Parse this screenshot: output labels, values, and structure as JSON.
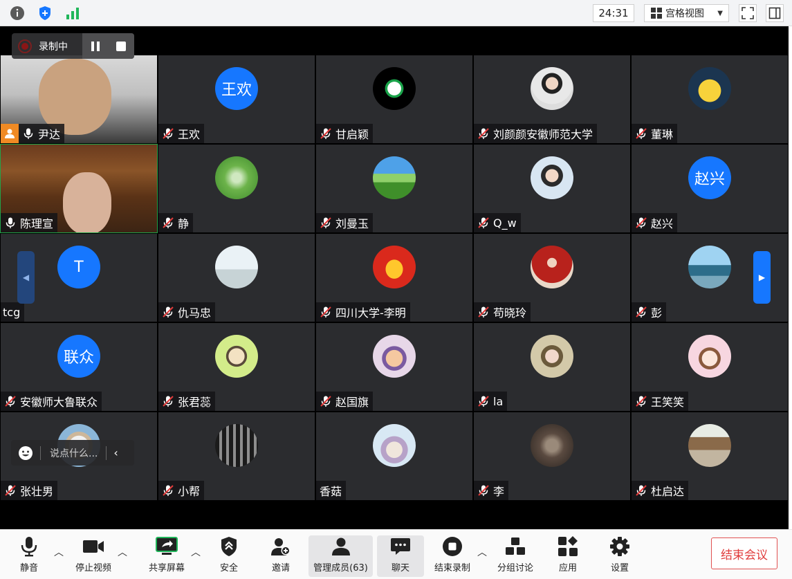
{
  "topbar": {
    "timer": "24:31",
    "view_label": "宫格视图",
    "icons": [
      "info-icon",
      "shield-icon",
      "signal-icon",
      "fullscreen-icon",
      "sidebar-toggle-icon"
    ]
  },
  "recording": {
    "label": "录制中"
  },
  "chat": {
    "placeholder": "说点什么..."
  },
  "colors": {
    "accent_blue": "#1677ff",
    "tile_bg": "#2b2c2f",
    "end_red": "#e03c3c"
  },
  "participants": [
    {
      "name": "尹达"
    },
    {
      "name": "王欢",
      "avatar_text": "王欢"
    },
    {
      "name": "甘启颖"
    },
    {
      "name": "刘颜颜安徽师范大学"
    },
    {
      "name": "董琳"
    },
    {
      "name": "陈理宣"
    },
    {
      "name": "静"
    },
    {
      "name": "刘曼玉"
    },
    {
      "name": "Q_w"
    },
    {
      "name": "赵兴",
      "avatar_text": "赵兴"
    },
    {
      "name": "tcg",
      "avatar_text": "T"
    },
    {
      "name": "仇马忠"
    },
    {
      "name": "四川大学-李明"
    },
    {
      "name": "苟晓玲"
    },
    {
      "name": "彭"
    },
    {
      "name": "安徽师大鲁联众",
      "avatar_text": "联众"
    },
    {
      "name": "张君蕊"
    },
    {
      "name": "赵国旗"
    },
    {
      "name": "la"
    },
    {
      "name": "王笑笑"
    },
    {
      "name": "张壮男"
    },
    {
      "name": "小帮"
    },
    {
      "name": "香菇"
    },
    {
      "name": "李"
    },
    {
      "name": "杜启达"
    }
  ],
  "toolbar": {
    "mute": "静音",
    "stop_video": "停止视频",
    "share_screen": "共享屏幕",
    "security": "安全",
    "invite": "邀请",
    "members": "管理成员(63)",
    "chat": "聊天",
    "end_recording": "结束录制",
    "breakout": "分组讨论",
    "apps": "应用",
    "settings": "设置",
    "end_meeting": "结束会议"
  }
}
